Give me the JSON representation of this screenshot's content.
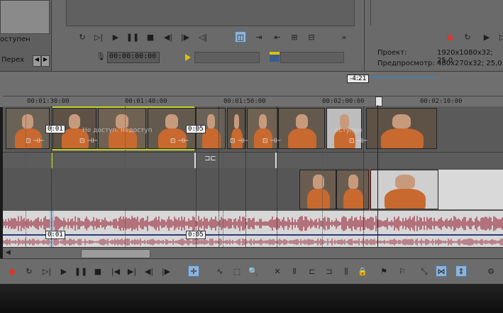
{
  "top_left": {
    "label_main": "оступен",
    "tab_label": "Перех"
  },
  "preview": {
    "timecode": "00:00:00:00",
    "project_label": "Проект:",
    "project_value": "1920x1080x32; 25,0",
    "preview_label": "Предпросмотр:",
    "preview_value": "480x270x32; 25,0"
  },
  "timeline": {
    "cursor_time": "-4:21",
    "ruler_labels": [
      "00:01:30:00",
      "00:01:40:00",
      "00:01:50:00",
      "00:02:00:00",
      "00:02:10:00"
    ],
    "clip_overlay_text": "Не доступ. недоступ",
    "clip_overlay_text2": "оступен",
    "marker_a": "0:01",
    "marker_b": "0:05",
    "audio_marker_a": "0:01",
    "audio_marker_b": "0:05"
  },
  "icons": {
    "preview_toolbar": [
      "loop-icon",
      "play-from-start-icon",
      "play-icon",
      "pause-icon",
      "stop-icon",
      "prev-frame-icon",
      "next-frame-icon",
      "prev-marker-icon",
      "split-screen-icon",
      "overlay-icon",
      "snapshot-icon",
      "copy-frame-icon",
      "grid-icon",
      "more-icon"
    ],
    "right_toolbar": [
      "record-icon",
      "loop-icon",
      "play-icon",
      "play-from-start-icon"
    ],
    "bottom_toolbar": [
      "record-icon",
      "loop-icon",
      "play-from-start-icon",
      "play-icon",
      "pause-icon",
      "stop-icon",
      "go-start-icon",
      "go-end-icon",
      "prev-frame-icon",
      "next-frame-icon",
      "normal-edit-tool-icon",
      "envelope-tool-icon",
      "selection-tool-icon",
      "zoom-tool-icon",
      "delete-icon",
      "trim-icon",
      "trim-start-icon",
      "trim-end-icon",
      "split-icon",
      "lock-icon",
      "marker-icon",
      "region-icon",
      "snapping-icon",
      "auto-crossfade-icon",
      "auto-ripple-icon",
      "settings-icon"
    ]
  },
  "colors": {
    "accent_red": "#d33a2c",
    "selection_blue": "#4a7aa8",
    "waveform": "#9b2d3e",
    "playhead": "#222222"
  }
}
